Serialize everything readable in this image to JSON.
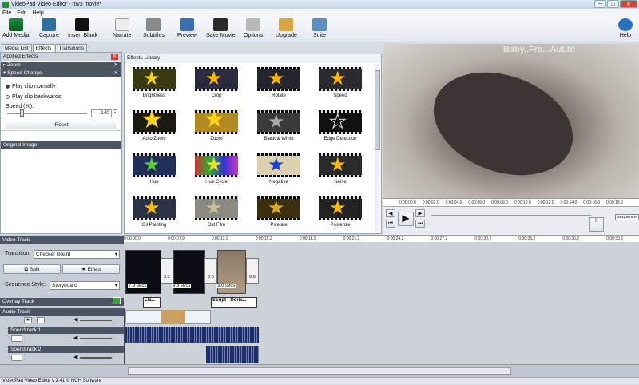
{
  "window": {
    "title": "VideoPad Video Editor - mv3 movie*"
  },
  "menu": [
    "File",
    "Edit",
    "Help"
  ],
  "toolbar": {
    "items": [
      "Add Media",
      "Capture",
      "Insert Blank",
      "Narrate",
      "Subtitles",
      "Preview",
      "Save Movie",
      "Options",
      "Upgrade",
      "Suite"
    ],
    "help": "Help"
  },
  "tabs": [
    "Media List",
    "Effects",
    "Transitions"
  ],
  "applied": {
    "title": "Applied Effects",
    "zoom": "Zoom",
    "speed": "Speed Change",
    "play_normal": "Play clip normally",
    "play_backwards": "Play clip backwards",
    "speed_label": "Speed (%):",
    "speed_value": "140",
    "reset": "Reset",
    "original": "Original Image"
  },
  "library": {
    "title": "Effects Library",
    "effects": [
      "Brightness",
      "Crop",
      "Rotate",
      "Speed",
      "Auto Zoom",
      "Zoom",
      "Black & White",
      "Edge Detection",
      "Hue",
      "Hue Cycle",
      "Negative",
      "Noise",
      "Oil Painting",
      "Old Film",
      "Pixelate",
      "Posterize"
    ]
  },
  "preview": {
    "watermark": "Baby..Fra...AuLtd",
    "times": [
      "0:00:00.0",
      "0:00:02.0",
      "0:00:04.0",
      "0:00:06.0",
      "0:00:08.0",
      "0:00:10.0",
      "0:00:12.0",
      "0:00:14.0",
      "0:00:16.0",
      "0:00:18.0"
    ],
    "sequence": "sequence"
  },
  "timeline": {
    "video_track": "Video Track",
    "transition_label": "Transition:",
    "transition_value": "Checker Board",
    "split": "Split",
    "effect": "Effect",
    "sequence_style_label": "Sequence Style:",
    "sequence_style_value": "Storyboard",
    "overlay_track": "Overlay Track",
    "audio_track": "Audio Track",
    "soundtrack1": "Soundtrack 1",
    "soundtrack2": "Soundtrack 2",
    "ruler": [
      "0:00:00.0",
      "0:00:07.9",
      "0:00:12.2",
      "0:00:15.2",
      "0:00:18.2",
      "0:00:21.2",
      "0:00:24.2",
      "0:00:27.2",
      "0:00:30.2",
      "0:00:33.2",
      "0:00:36.2",
      "0:00:39.2"
    ],
    "clip1_secs": "7.9 secs",
    "clip2_secs": "4.3 secs",
    "clip3_secs": "3.0 secs",
    "trans1": "3.2",
    "trans2": "0.0",
    "trans3": "0.0",
    "overlay1": "Lla...",
    "overlay2": "Script - Doria..."
  },
  "status": "VideoPad Video Editor v 2.41 © NCH Software"
}
